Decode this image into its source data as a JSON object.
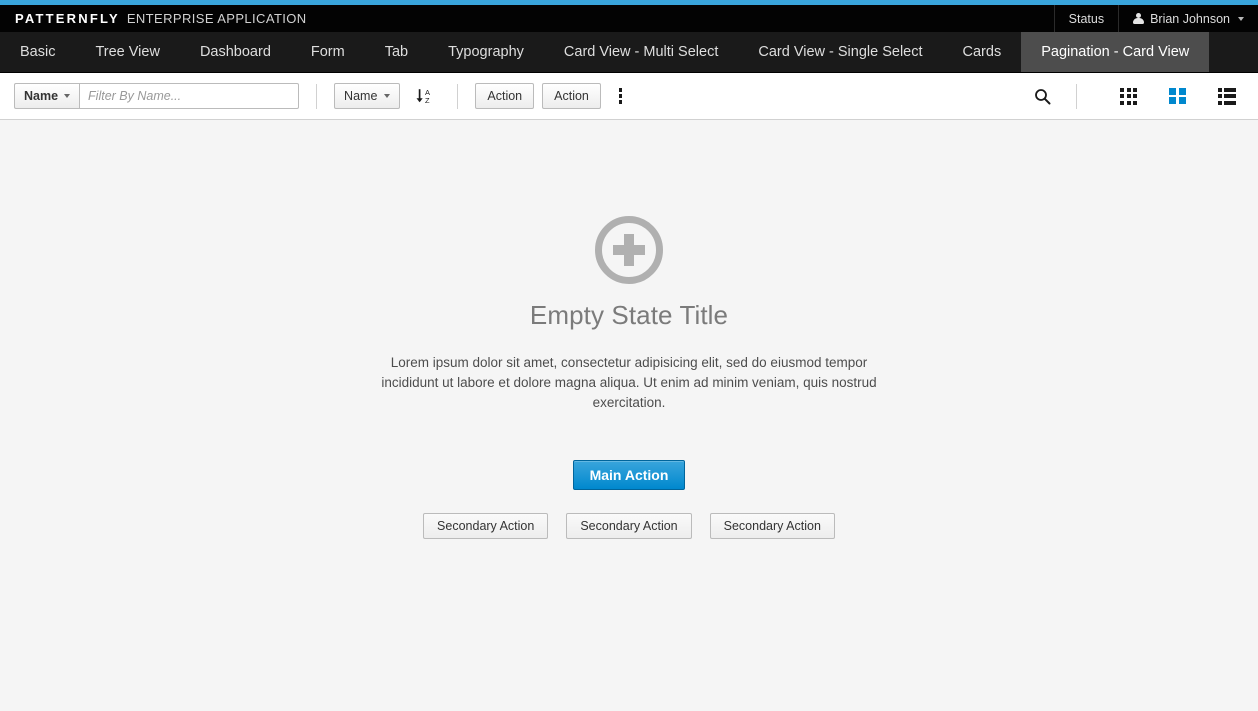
{
  "masthead": {
    "brand_name": "PATTERNFLY",
    "brand_subtitle": "ENTERPRISE APPLICATION",
    "status_label": "Status",
    "user_name": "Brian Johnson",
    "accent_color": "#39a5dc",
    "background_color": "#030303"
  },
  "nav": {
    "items": [
      {
        "label": "Basic",
        "active": false
      },
      {
        "label": "Tree View",
        "active": false
      },
      {
        "label": "Dashboard",
        "active": false
      },
      {
        "label": "Form",
        "active": false
      },
      {
        "label": "Tab",
        "active": false
      },
      {
        "label": "Typography",
        "active": false
      },
      {
        "label": "Card View - Multi Select",
        "active": false
      },
      {
        "label": "Card View - Single Select",
        "active": false
      },
      {
        "label": "Cards",
        "active": false
      },
      {
        "label": "Pagination - Card View",
        "active": true
      }
    ]
  },
  "toolbar": {
    "filter_field_label": "Name",
    "filter_placeholder": "Filter By Name...",
    "filter_value": "",
    "sort_field_label": "Name",
    "sort_direction_icon": "sort-alpha-asc-icon",
    "action_1_label": "Action",
    "action_2_label": "Action",
    "kebab_icon": "kebab-vertical-icon",
    "search_icon": "search-icon",
    "views": [
      {
        "name": "table-view",
        "icon": "grid-9-icon",
        "active": false
      },
      {
        "name": "card-view",
        "icon": "grid-4-icon",
        "active": true
      },
      {
        "name": "list-view",
        "icon": "list-icon",
        "active": false
      }
    ],
    "active_view_color": "#0088ce"
  },
  "empty_state": {
    "icon": "plus-circle-icon",
    "title": "Empty State Title",
    "body_line_1": "Lorem ipsum dolor sit amet, consectetur adipisicing elit, sed do eiusmod tempor",
    "body_line_2": "incididunt ut labore et dolore magna aliqua. Ut enim ad minim veniam, quis nostrud exercitation.",
    "primary_action_label": "Main Action",
    "secondary_actions": [
      "Secondary Action",
      "Secondary Action",
      "Secondary Action"
    ],
    "primary_color": "#0088ce"
  }
}
